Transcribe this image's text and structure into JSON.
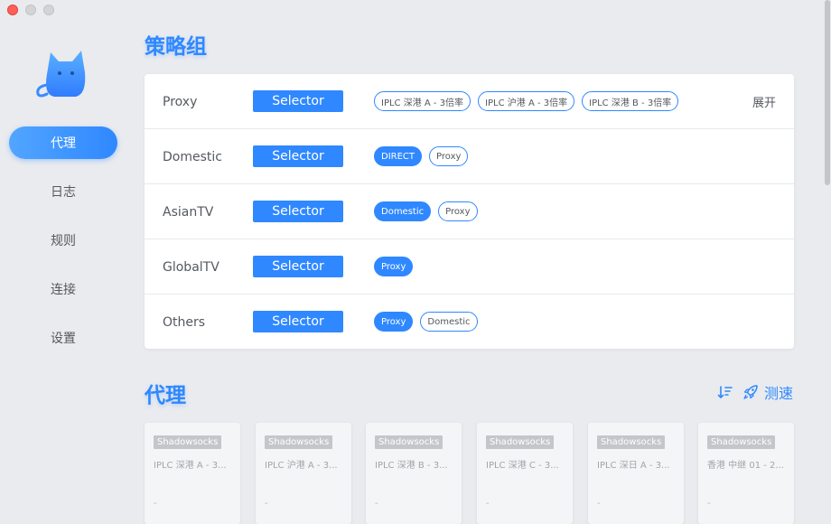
{
  "sidebar": {
    "items": [
      {
        "label": "代理",
        "active": true
      },
      {
        "label": "日志"
      },
      {
        "label": "规则"
      },
      {
        "label": "连接"
      },
      {
        "label": "设置"
      }
    ]
  },
  "groups": {
    "title": "策略组",
    "expand_label": "展开",
    "selector_label": "Selector",
    "rows": [
      {
        "name": "Proxy",
        "tags": [
          "IPLC 深港 A - 3倍率",
          "IPLC 沪港 A - 3倍率",
          "IPLC 深港 B - 3倍率"
        ],
        "selected": -1
      },
      {
        "name": "Domestic",
        "tags": [
          "DIRECT",
          "Proxy"
        ],
        "selected": 0
      },
      {
        "name": "AsianTV",
        "tags": [
          "Domestic",
          "Proxy"
        ],
        "selected": 0
      },
      {
        "name": "GlobalTV",
        "tags": [
          "Proxy"
        ],
        "selected": 0
      },
      {
        "name": "Others",
        "tags": [
          "Proxy",
          "Domestic"
        ],
        "selected": 0
      }
    ]
  },
  "proxies": {
    "title": "代理",
    "speedtest_label": "测速",
    "cards": [
      {
        "type": "Shadowsocks",
        "name": "IPLC 深港 A - 3...",
        "delay": "-"
      },
      {
        "type": "Shadowsocks",
        "name": "IPLC 沪港 A - 3...",
        "delay": "-"
      },
      {
        "type": "Shadowsocks",
        "name": "IPLC 深港 B - 3...",
        "delay": "-"
      },
      {
        "type": "Shadowsocks",
        "name": "IPLC 深港 C - 3...",
        "delay": "-"
      },
      {
        "type": "Shadowsocks",
        "name": "IPLC 深日 A - 3...",
        "delay": "-"
      },
      {
        "type": "Shadowsocks",
        "name": "香港 中继 01 - 2...",
        "delay": "-"
      }
    ]
  },
  "colors": {
    "accent": "#2f88ff",
    "background": "#e9ebef"
  }
}
